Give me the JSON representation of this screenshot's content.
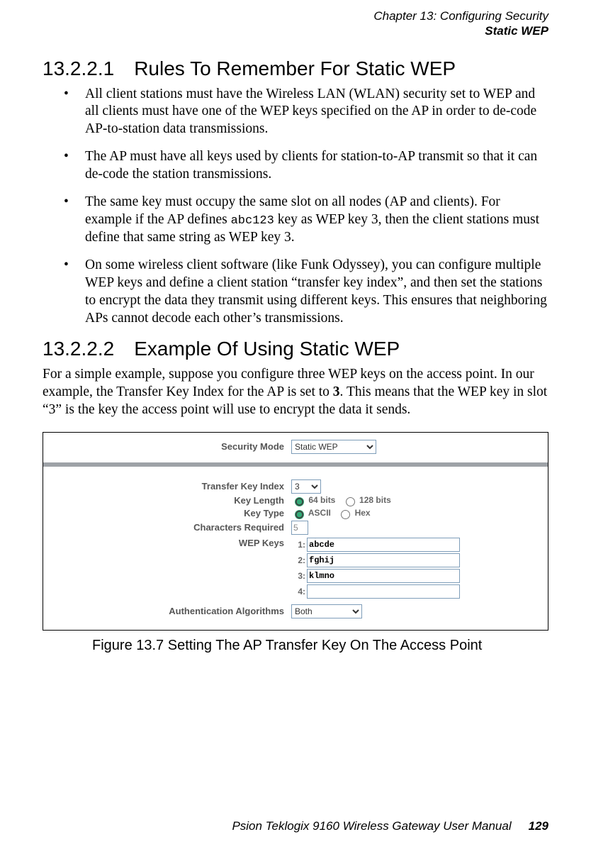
{
  "header": {
    "chapter": "Chapter 13:  Configuring Security",
    "section": "Static WEP"
  },
  "s1": {
    "num": "13.2.2.1",
    "title": "Rules To Remember For Static WEP",
    "b1": "All client stations must have the Wireless LAN (WLAN) security set to WEP and all clients must have one of the WEP keys specified on the AP in order to de-code AP-to-station data transmissions.",
    "b2": "The AP must have all keys used by clients for station-to-AP transmit so that it can de-code the station transmissions.",
    "b3a": "The same key must occupy the same slot on all nodes (AP and clients). For example if the AP defines ",
    "b3code": "abc123",
    "b3b": " key as WEP key 3, then the client stations must define that same string as WEP key 3.",
    "b4": "On some wireless client software (like Funk Odyssey), you can configure multiple WEP keys and define a client station “transfer key index”, and then set the stations to encrypt the data they transmit using different keys. This ensures that neighboring APs cannot decode each other’s transmissions."
  },
  "s2": {
    "num": "13.2.2.2",
    "title": "Example Of Using Static WEP",
    "para_a": "For a simple example, suppose you configure three WEP keys on the access point. In our example, the Transfer Key Index for the AP is set to ",
    "para_bold": "3",
    "para_b": ". This means that the WEP key in slot “3” is the key the access point will use to encrypt the data it sends."
  },
  "figure": {
    "labels": {
      "security_mode": "Security Mode",
      "transfer_key_index": "Transfer Key Index",
      "key_length": "Key Length",
      "key_type": "Key Type",
      "chars_required": "Characters Required",
      "wep_keys": "WEP Keys",
      "auth_algo": "Authentication Algorithms"
    },
    "values": {
      "security_mode": "Static WEP",
      "transfer_key_index": "3",
      "key_length_64": "64 bits",
      "key_length_128": "128 bits",
      "key_type_ascii": "ASCII",
      "key_type_hex": "Hex",
      "chars_required": "5",
      "k1num": "1:",
      "k2num": "2:",
      "k3num": "3:",
      "k4num": "4:",
      "key1": "abcde",
      "key2": "fghij",
      "key3": "klmno",
      "key4": "",
      "auth_algo": "Both"
    },
    "caption": "Figure 13.7 Setting The AP Transfer Key On The Access Point"
  },
  "footer": {
    "text": "Psion Teklogix 9160 Wireless Gateway User Manual",
    "page": "129"
  }
}
